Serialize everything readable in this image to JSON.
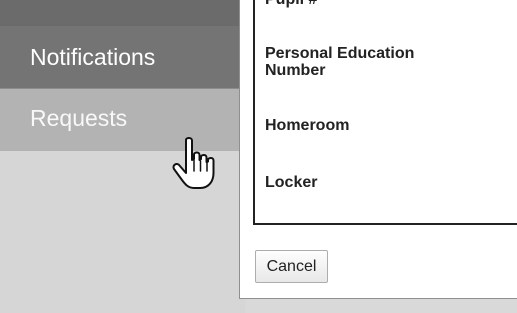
{
  "sidebar": {
    "items": [
      {
        "label": "Notifications",
        "state": "default"
      },
      {
        "label": "Requests",
        "state": "hover"
      }
    ]
  },
  "cursor": {
    "icon": "pointer-hand-icon"
  },
  "dialog": {
    "fields": [
      {
        "label": "Pupil #"
      },
      {
        "label": "Personal Education\nNumber"
      },
      {
        "label": "Homeroom"
      },
      {
        "label": "Locker"
      }
    ],
    "cancel_label": "Cancel"
  },
  "colors": {
    "sidebar_bg": "#d6d6d6",
    "nav_dark": "#747474",
    "nav_hover": "#b3b3b3",
    "dialog_bg": "#ffffff",
    "box_border": "#222222"
  }
}
